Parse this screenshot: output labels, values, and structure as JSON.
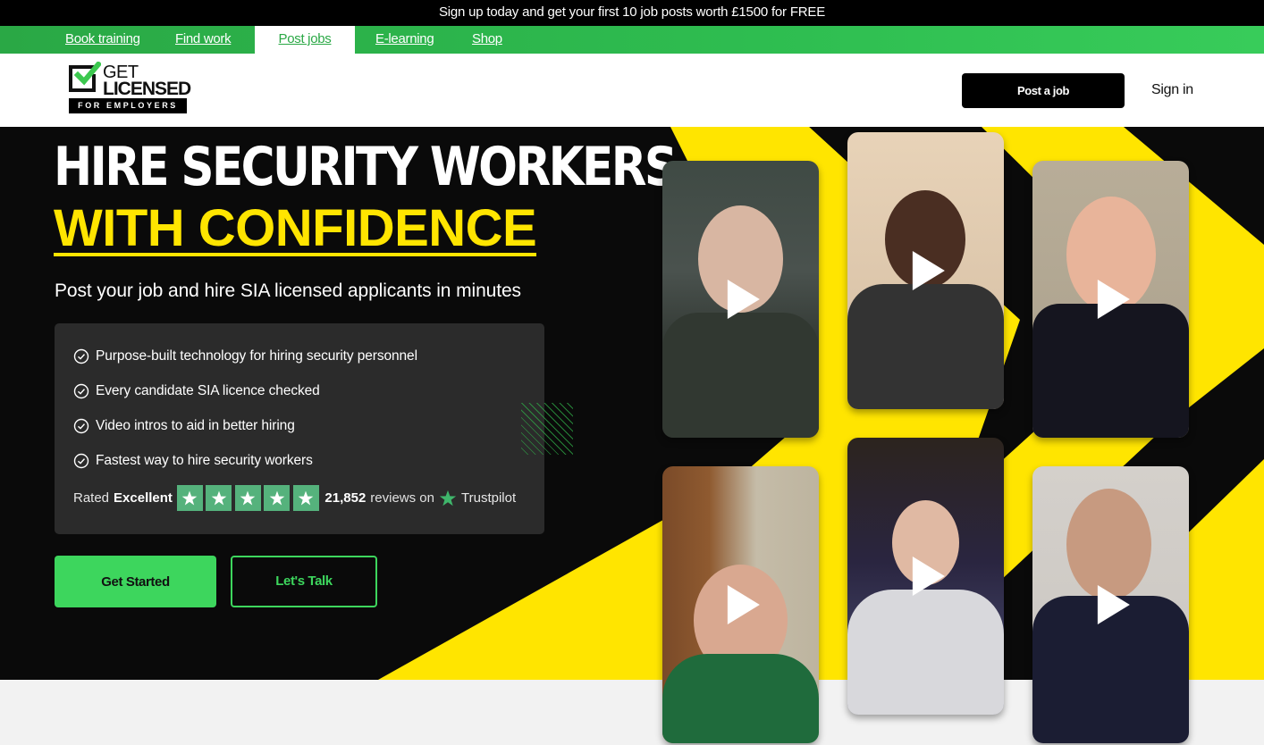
{
  "promo_banner": "Sign up today and get your first 10 job posts worth £1500 for FREE",
  "top_nav": [
    {
      "label": "Book training",
      "active": false
    },
    {
      "label": "Find work",
      "active": false
    },
    {
      "label": "Post jobs",
      "active": true
    },
    {
      "label": "E-learning",
      "active": false
    },
    {
      "label": "Shop",
      "active": false
    }
  ],
  "header": {
    "logo": {
      "line1": "GET",
      "line2": "LICENSED",
      "tagline": "FOR EMPLOYERS"
    },
    "post_job_label": "Post a job",
    "sign_in_label": "Sign in"
  },
  "hero": {
    "title_line1": "HIRE SECURITY WORKERS",
    "title_line2": "WITH CONFIDENCE",
    "subtitle": "Post your job and hire SIA licensed applicants in minutes",
    "features": [
      "Purpose-built technology for hiring security personnel",
      "Every candidate SIA licence checked",
      "Video intros to aid in better hiring",
      "Fastest way to hire security workers"
    ],
    "rating": {
      "rated_label": "Rated",
      "rating_word": "Excellent",
      "stars": 5,
      "review_count": "21,852",
      "reviews_on": "reviews on",
      "platform": "Trustpilot"
    },
    "cta_primary": "Get Started",
    "cta_secondary": "Let's Talk"
  },
  "video_cards": [
    {
      "name": "candidate-video-1",
      "icon": "play-icon"
    },
    {
      "name": "candidate-video-2",
      "icon": "play-icon"
    },
    {
      "name": "candidate-video-3",
      "icon": "play-icon"
    },
    {
      "name": "candidate-video-4",
      "icon": "play-icon"
    },
    {
      "name": "candidate-video-5",
      "icon": "play-icon"
    },
    {
      "name": "candidate-video-6",
      "icon": "play-icon"
    }
  ],
  "colors": {
    "brand_green": "#2ebd50",
    "button_green": "#3dd65d",
    "accent_yellow": "#ffe500",
    "hero_bg": "#0a0a0a",
    "panel_bg": "#2b2b2b",
    "trustpilot_green": "#55b27c"
  }
}
